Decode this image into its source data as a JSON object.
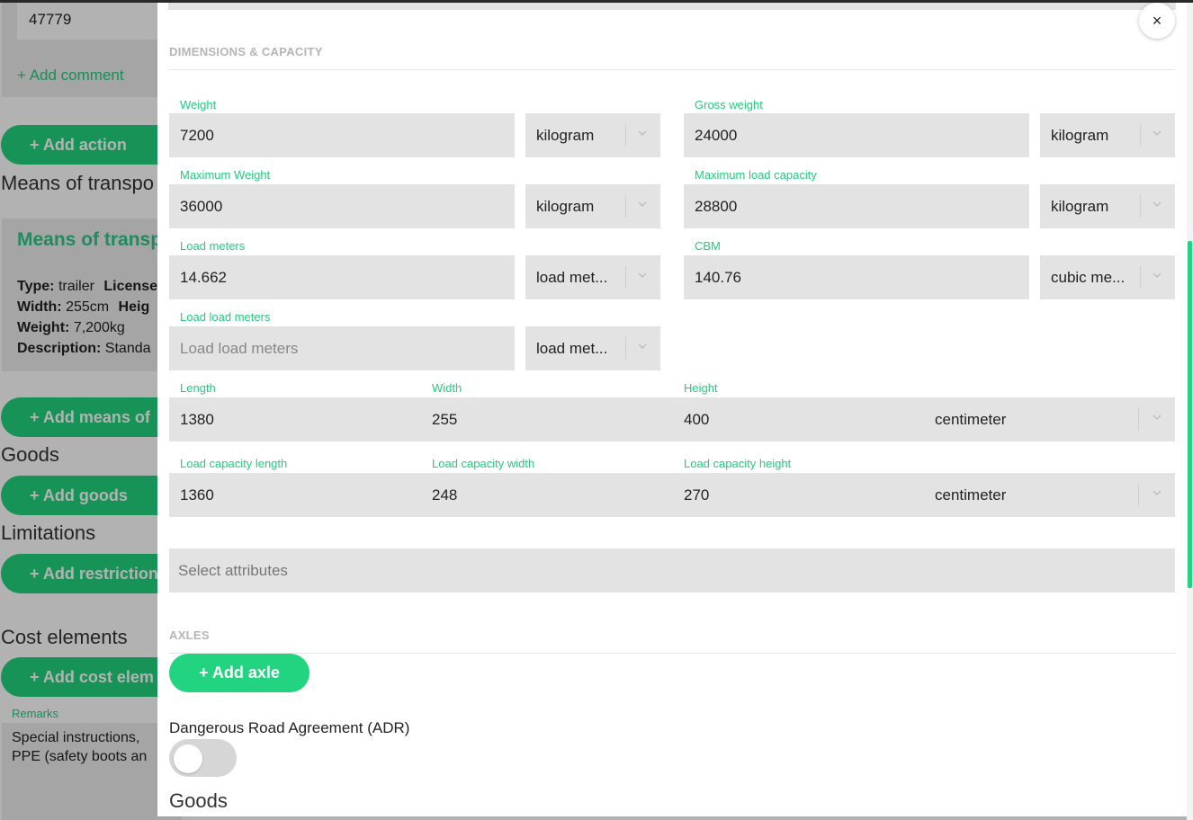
{
  "background": {
    "comment_value": "47779",
    "add_comment": "+ Add comment",
    "add_action": "+ Add action",
    "means_heading": "Means of transpo",
    "card_title": "Means of transp",
    "card": {
      "type_label": "Type:",
      "type_value": "trailer",
      "license_label": "License",
      "width_label": "Width:",
      "width_value": "255cm",
      "height_label": "Heig",
      "weight_label": "Weight:",
      "weight_value": "7,200kg",
      "desc_label": "Description:",
      "desc_value": "Standa"
    },
    "add_means": "+ Add means of",
    "goods_heading": "Goods",
    "add_goods": "+ Add goods",
    "limitations_heading": "Limitations",
    "add_restriction": "+ Add restriction",
    "cost_heading": "Cost elements",
    "add_cost": "+ Add cost elem",
    "remarks_label": "Remarks",
    "remarks_line1": "Special instructions,",
    "remarks_line2": "PPE (safety boots an"
  },
  "modal": {
    "close_glyph": "×",
    "dimensions_section": "DIMENSIONS & CAPACITY",
    "weight": {
      "label": "Weight",
      "value": "7200",
      "unit": "kilogram"
    },
    "gross_weight": {
      "label": "Gross weight",
      "value": "24000",
      "unit": "kilogram"
    },
    "max_weight": {
      "label": "Maximum Weight",
      "value": "36000",
      "unit": "kilogram"
    },
    "max_load_capacity": {
      "label": "Maximum load capacity",
      "value": "28800",
      "unit": "kilogram"
    },
    "load_meters": {
      "label": "Load meters",
      "value": "14.662",
      "unit": "load met..."
    },
    "cbm": {
      "label": "CBM",
      "value": "140.76",
      "unit": "cubic me..."
    },
    "load_load_meters": {
      "label": "Load load meters",
      "placeholder": "Load load meters",
      "unit": "load met..."
    },
    "length": {
      "label": "Length",
      "value": "1380"
    },
    "width": {
      "label": "Width",
      "value": "255"
    },
    "height": {
      "label": "Height",
      "value": "400"
    },
    "dim_unit": "centimeter",
    "lc_length": {
      "label": "Load capacity length",
      "value": "1360"
    },
    "lc_width": {
      "label": "Load capacity width",
      "value": "248"
    },
    "lc_height": {
      "label": "Load capacity height",
      "value": "270"
    },
    "lc_unit": "centimeter",
    "attributes_placeholder": "Select attributes",
    "axles_section": "AXLES",
    "add_axle": "+ Add axle",
    "adr_label": "Dangerous Road Agreement (ADR)",
    "adr_enabled": false,
    "goods_heading": "Goods"
  }
}
